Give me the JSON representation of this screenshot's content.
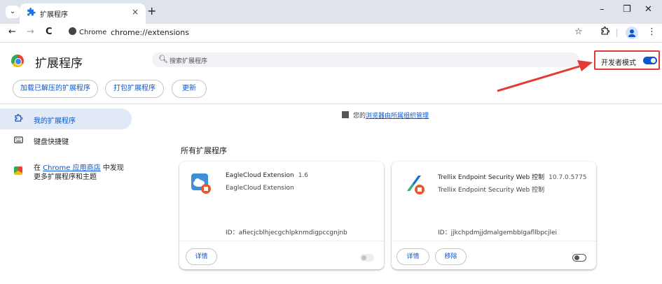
{
  "browser": {
    "tab_title": "扩展程序",
    "tab_close": "×",
    "new_tab": "+",
    "tab_search": "⌄",
    "chip_label": "Chrome",
    "url": "chrome://extensions",
    "window_min": "–",
    "window_restore": "❐",
    "window_close": "✕",
    "back": "←",
    "forward": "→",
    "reload": "C",
    "star": "☆",
    "menu": "⋮"
  },
  "header": {
    "title": "扩展程序",
    "search_placeholder": "搜索扩展程序",
    "developer_mode_label": "开发者模式",
    "developer_mode_on": true,
    "buttons": {
      "load_unpacked": "加载已解压的扩展程序",
      "pack": "打包扩展程序",
      "update": "更新"
    }
  },
  "sidebar": {
    "items": [
      {
        "label": "我的扩展程序",
        "icon": "puzzle-icon",
        "active": true
      },
      {
        "label": "键盘快捷键",
        "icon": "keyboard-icon",
        "active": false
      }
    ],
    "store_prefix": "在 ",
    "store_link": "Chrome 应用商店",
    "store_mid": " 中发现",
    "store_suffix": "更多扩展程序和主题"
  },
  "main": {
    "managed_prefix": "您的",
    "managed_link": "浏览器由所属组织管理",
    "section_title": "所有扩展程序",
    "extensions": [
      {
        "name": "EagleCloud Extension",
        "version": "1.6",
        "description": "EagleCloud Extension",
        "id_text": "ID：afiecjcblhjecgchlpknmdigpccgnjnb",
        "buttons": [
          "详情"
        ],
        "enabled": false,
        "icon": "eaglecloud-icon"
      },
      {
        "name": "Trellix Endpoint Security Web 控制",
        "version": "10.7.0.5775",
        "description": "Trellix Endpoint Security Web 控制",
        "id_text": "ID：jjkchpdmjjdmalgembbIgafllbpcjlei",
        "buttons": [
          "详情",
          "移除"
        ],
        "enabled": false,
        "icon": "trellix-icon"
      }
    ]
  },
  "colors": {
    "accent": "#0b57d0",
    "highlight_box": "#e53935",
    "arrow": "#e53935"
  }
}
